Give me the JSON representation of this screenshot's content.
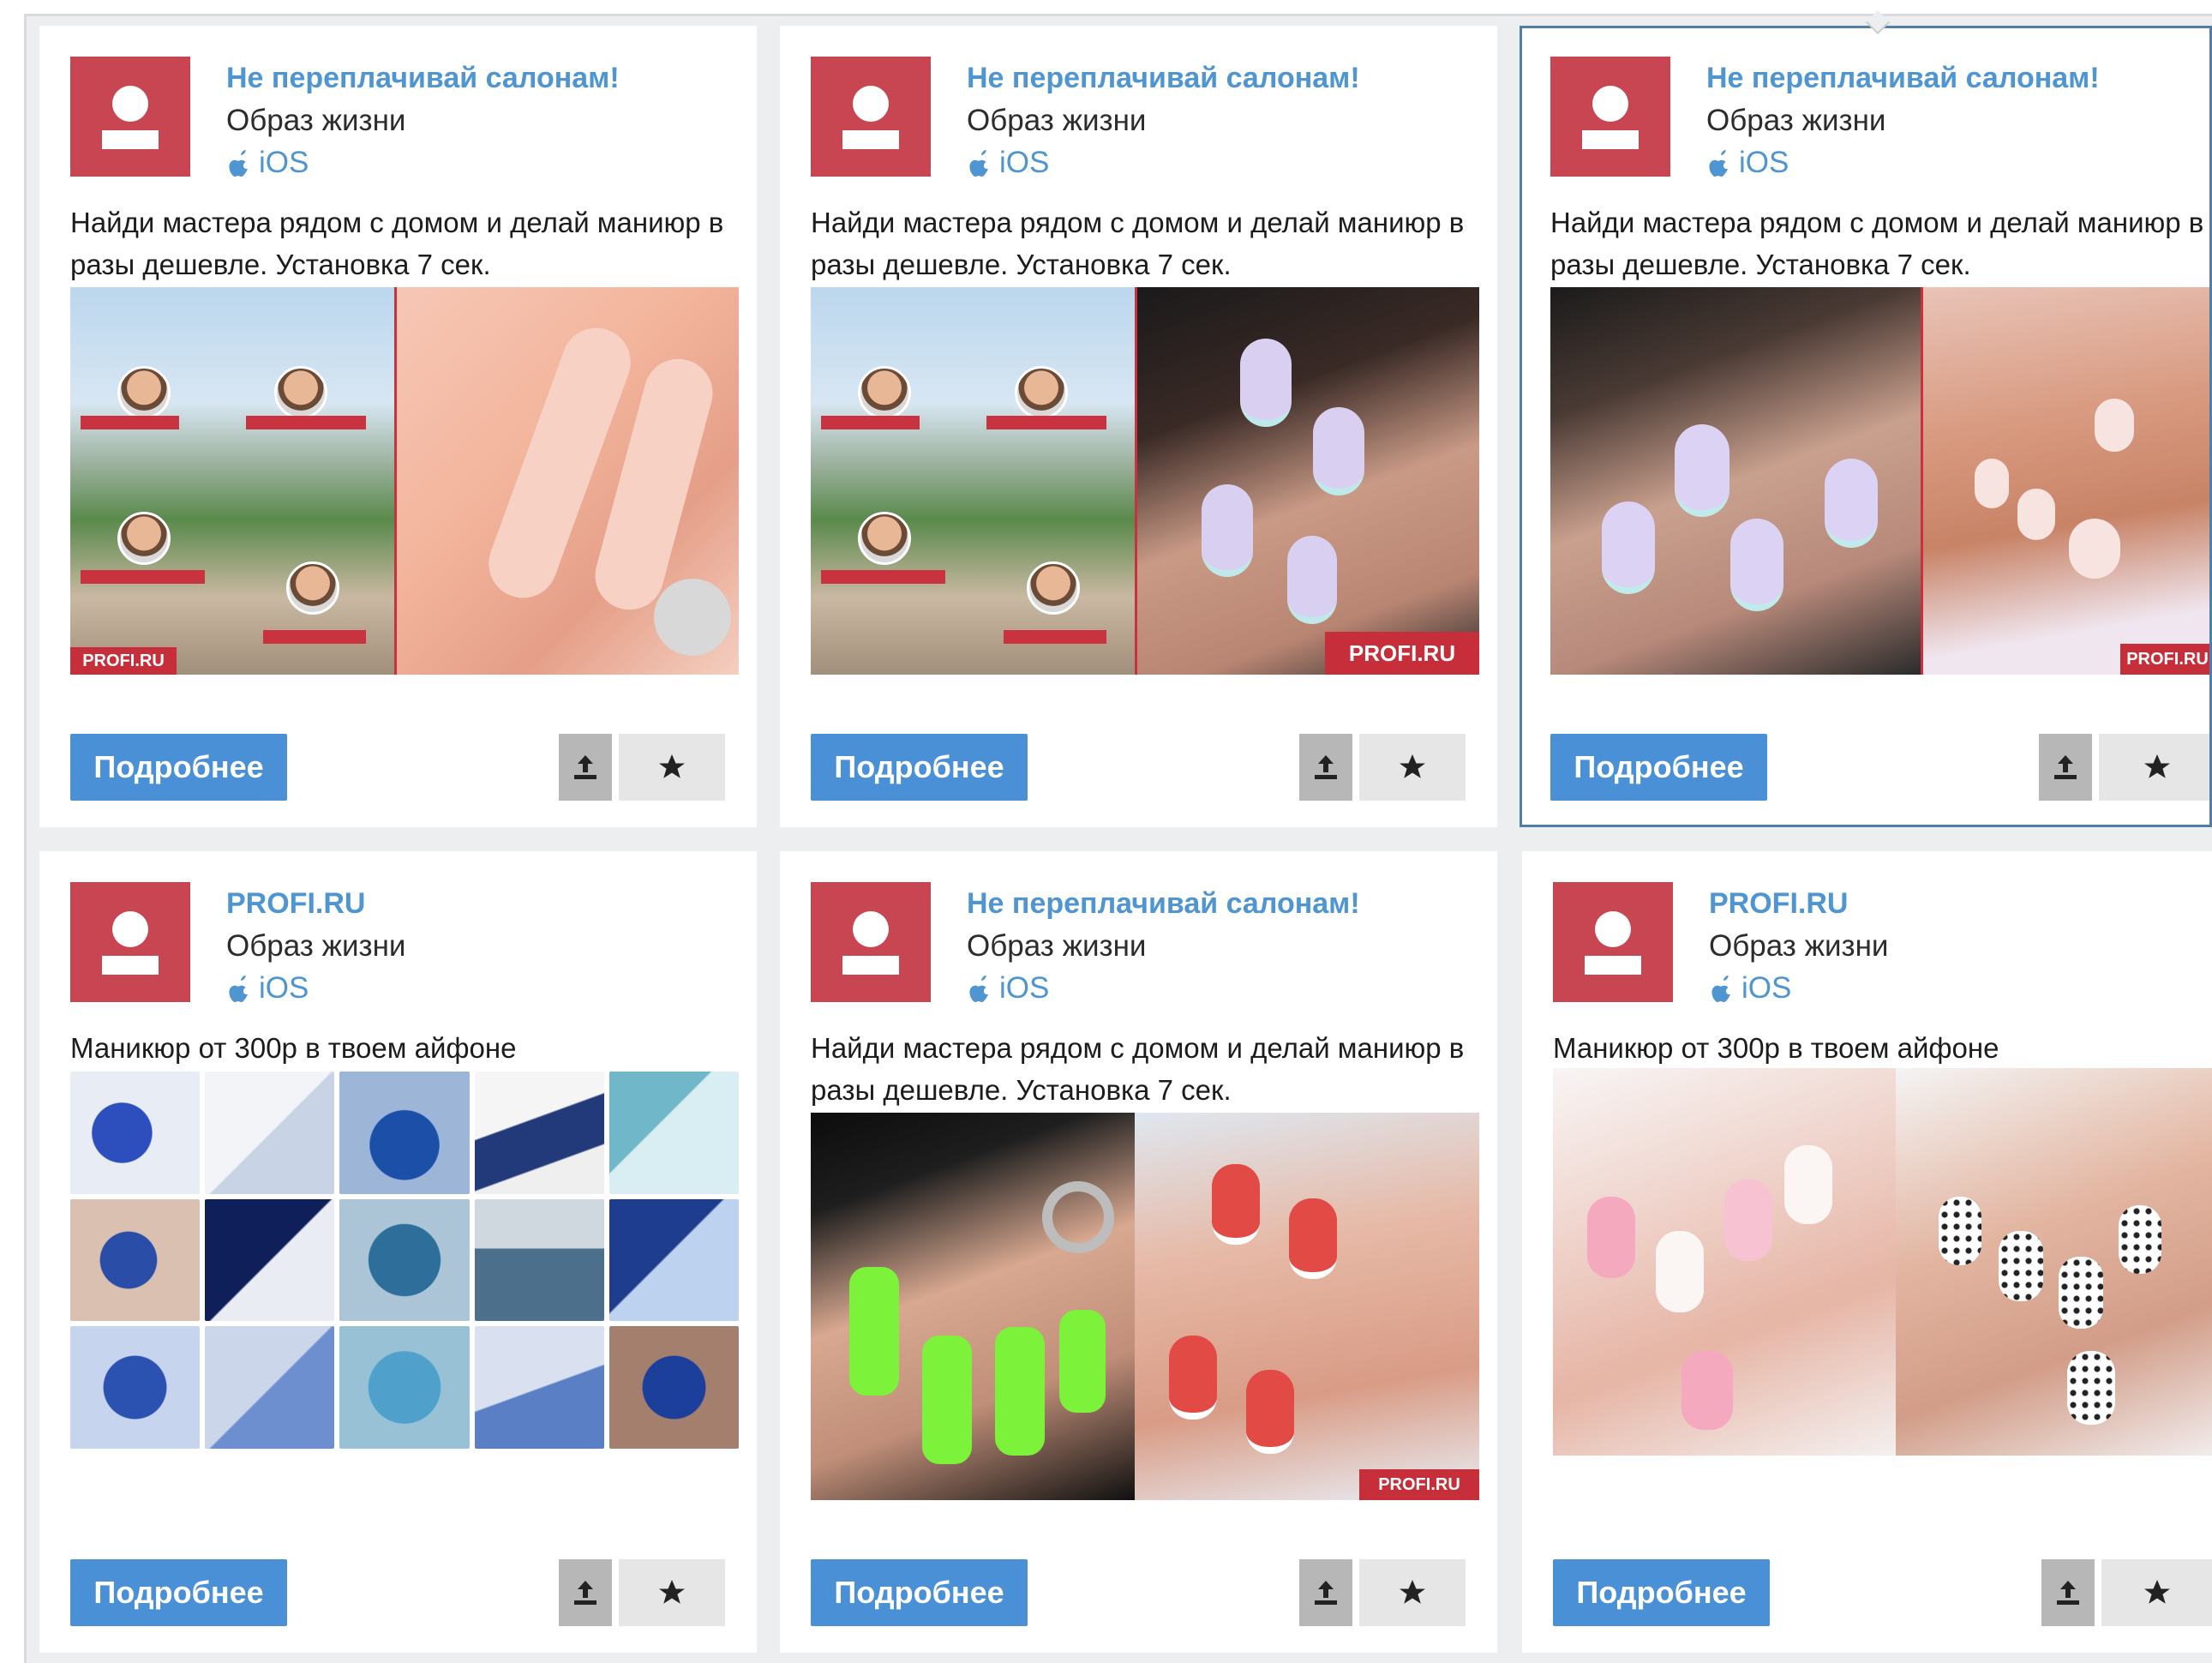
{
  "cards": [
    {
      "title": "Не переплачивай салонам!",
      "category": "Образ жизни",
      "platform": "iOS",
      "description": "Найди мастера рядом с домом и делай маниюр в разы дешевле. Установка 7 сек.",
      "brand_label": "PROFI.RU",
      "image_set": "city-masters + manicure-closeup",
      "more_button": "Подробнее"
    },
    {
      "title": "Не переплачивай салонам!",
      "category": "Образ жизни",
      "platform": "iOS",
      "description": "Найди мастера рядом с домом и делай маниюр в разы дешевле. Установка 7 сек.",
      "brand_label": "PROFI.RU",
      "image_set": "city-masters + lavender-nails",
      "more_button": "Подробнее"
    },
    {
      "title": "Не переплачивай салонам!",
      "category": "Образ жизни",
      "platform": "iOS",
      "description": "Найди мастера рядом с домом и делай маниюр в разы дешевле. Установка 7 сек.",
      "brand_label": "PROFI.RU",
      "image_set": "lavender-nails + pedicure",
      "more_button": "Подробнее",
      "selected": true
    },
    {
      "title": "PROFI.RU",
      "category": "Образ жизни",
      "platform": "iOS",
      "description": "Маникюр от 300р в твоем айфоне",
      "brand_label": "",
      "image_set": "blue-nails-collage",
      "more_button": "Подробнее"
    },
    {
      "title": "Не переплачивай салонам!",
      "category": "Образ жизни",
      "platform": "iOS",
      "description": "Найди мастера рядом с домом и делай маниюр в разы дешевле. Установка 7 сек.",
      "brand_label": "PROFI.RU",
      "image_set": "green-nails + red-nails",
      "more_button": "Подробнее"
    },
    {
      "title": "PROFI.RU",
      "category": "Образ жизни",
      "platform": "iOS",
      "description": "Маникюр от 300р в твоем айфоне",
      "brand_label": "",
      "image_set": "pink-nails + polka-dot-nails",
      "more_button": "Подробнее"
    }
  ],
  "icons": {
    "avatar": "user-avatar-icon",
    "platform": "apple-icon",
    "share": "share-upload-icon",
    "favorite": "star-icon"
  },
  "colors": {
    "title_blue": "#4e95d1",
    "button_blue": "#4a90d6",
    "avatar_red": "#c84552",
    "brand_red": "#c62f3a",
    "selected_border": "#4f7fa6"
  }
}
